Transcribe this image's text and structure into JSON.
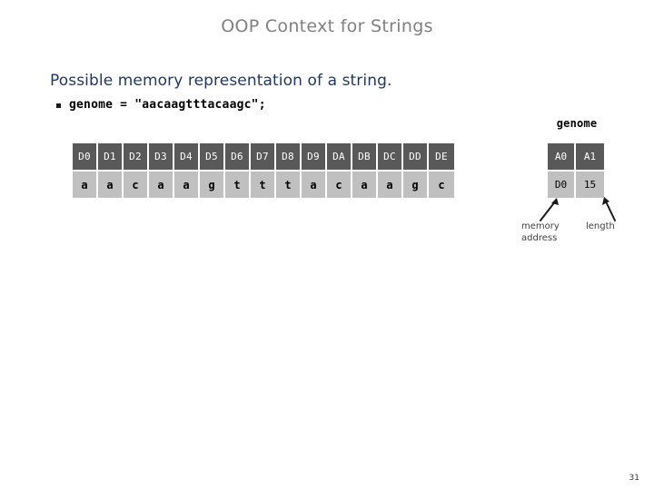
{
  "slide": {
    "title": "OOP Context for Strings",
    "title_color": "#808080",
    "heading": "Possible memory representation of a string.",
    "heading_color": "#1f3864",
    "page_number": "31",
    "background_color": "#ffffff"
  },
  "bullet": {
    "marker": "square-bullet",
    "code": "genome = \"aacaagtttacaagc\";"
  },
  "memory_table": {
    "addresses": [
      "D0",
      "D1",
      "D2",
      "D3",
      "D4",
      "D5",
      "D6",
      "D7",
      "D8",
      "D9",
      "DA",
      "DB",
      "DC",
      "DD",
      "DE"
    ],
    "characters": [
      "a",
      "a",
      "c",
      "a",
      "a",
      "g",
      "t",
      "t",
      "t",
      "a",
      "c",
      "a",
      "a",
      "g",
      "c"
    ],
    "header_bg": "#595959",
    "header_fg": "#ffffff",
    "cell_bg": "#c0c0c0",
    "cell_fg": "#000000"
  },
  "object_table": {
    "label": "genome",
    "addresses": [
      "A0",
      "A1"
    ],
    "values": [
      "D0",
      "15"
    ],
    "header_bg": "#595959",
    "cell_bg": "#c0c0c0"
  },
  "annotations": {
    "memory_address": "memory\naddress",
    "length": "length",
    "arrow_left": "arrow-up-right",
    "arrow_right": "arrow-up-left"
  }
}
